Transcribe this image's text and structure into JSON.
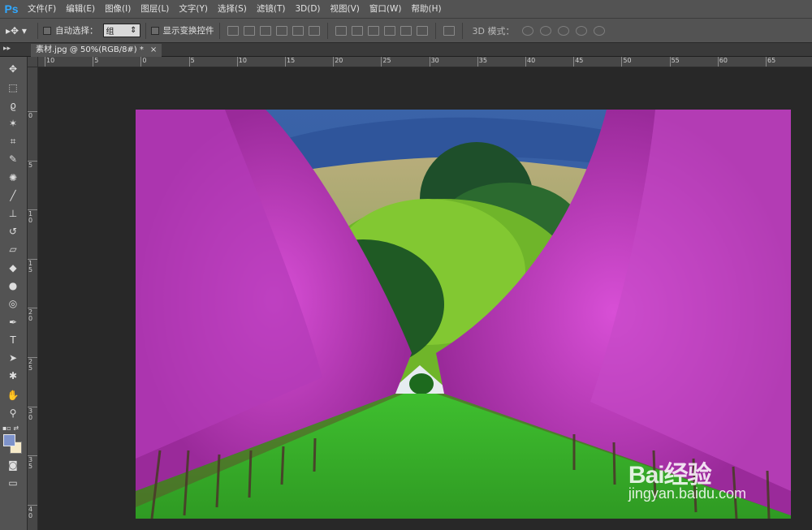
{
  "app": {
    "logo": "Ps"
  },
  "menu": [
    "文件(F)",
    "编辑(E)",
    "图像(I)",
    "图层(L)",
    "文字(Y)",
    "选择(S)",
    "滤镜(T)",
    "3D(D)",
    "视图(V)",
    "窗口(W)",
    "帮助(H)"
  ],
  "options": {
    "auto_select_label": "自动选择：",
    "auto_select_value": "组",
    "show_transform_label": "显示变换控件",
    "mode_3d_label": "3D 模式："
  },
  "document_tab": {
    "title": "素材.jpg @ 50%(RGB/8#) *",
    "close": "×"
  },
  "rulers": {
    "horizontal": [
      "10",
      "5",
      "0",
      "5",
      "10",
      "15",
      "20",
      "25",
      "30",
      "35",
      "40",
      "45",
      "50",
      "55",
      "60",
      "65"
    ],
    "vertical": [
      "0",
      "5",
      "10",
      "15",
      "20",
      "25",
      "30",
      "35",
      "40"
    ]
  },
  "colors": {
    "foreground": "#7e93cb",
    "background": "#f6eac9",
    "ps_blue": "#31a8ff"
  },
  "image": {
    "watermark_brand": "Bai经验",
    "watermark_url": "jingyan.baidu.com"
  },
  "tools": [
    "move-tool-icon",
    "marquee-tool-icon",
    "lasso-tool-icon",
    "magic-wand-icon",
    "crop-tool-icon",
    "eyedropper-icon",
    "healing-brush-icon",
    "brush-tool-icon",
    "clone-stamp-icon",
    "history-brush-icon",
    "eraser-icon",
    "paint-bucket-icon",
    "blur-tool-icon",
    "dodge-tool-icon",
    "pen-tool-icon",
    "type-tool-icon",
    "path-select-icon",
    "shape-tool-icon",
    "hand-tool-icon",
    "zoom-tool-icon"
  ]
}
